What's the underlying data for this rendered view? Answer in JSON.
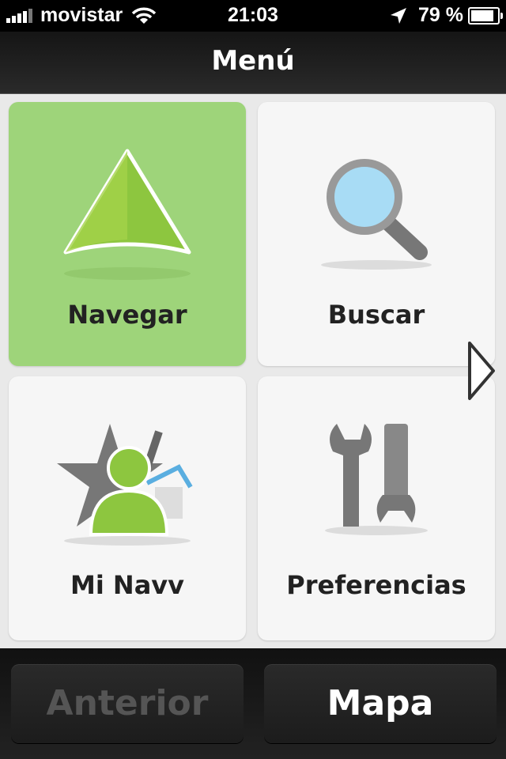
{
  "status": {
    "carrier": "movistar",
    "time": "21:03",
    "battery": "79 %",
    "battery_level": 0.79
  },
  "header": {
    "title": "Menú"
  },
  "menu": {
    "tiles": [
      {
        "label": "Navegar",
        "icon": "navigation-arrow-icon",
        "active": true
      },
      {
        "label": "Buscar",
        "icon": "magnifier-icon"
      },
      {
        "label": "Mi Navv",
        "icon": "user-favorites-icon"
      },
      {
        "label": "Preferencias",
        "icon": "wrench-tools-icon"
      }
    ]
  },
  "footer": {
    "prev_label": "Anterior",
    "map_label": "Mapa"
  },
  "colors": {
    "active_tile": "#9ed47a",
    "tile": "#f6f6f6",
    "background": "#e9e9e9"
  }
}
